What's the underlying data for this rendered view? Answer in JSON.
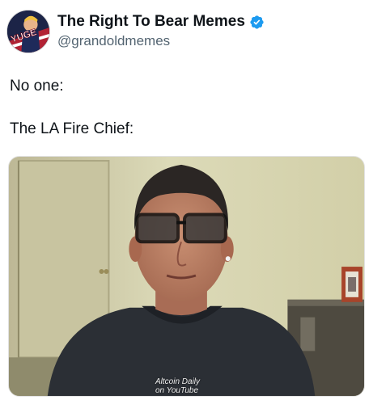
{
  "author": {
    "display_name": "The Right To Bear Memes",
    "handle": "@grandoldmemes",
    "verified": true,
    "avatar_icon": "yuge-avatar-icon",
    "avatar_text": "YUGE"
  },
  "post": {
    "line1": "No one:",
    "line2": "The LA Fire Chief:"
  },
  "media": {
    "watermark_line1": "Altcoin Daily",
    "watermark_line2": "on YouTube"
  },
  "colors": {
    "verified_blue": "#1d9bf0",
    "text_primary": "#0f1419",
    "text_secondary": "#536471"
  }
}
